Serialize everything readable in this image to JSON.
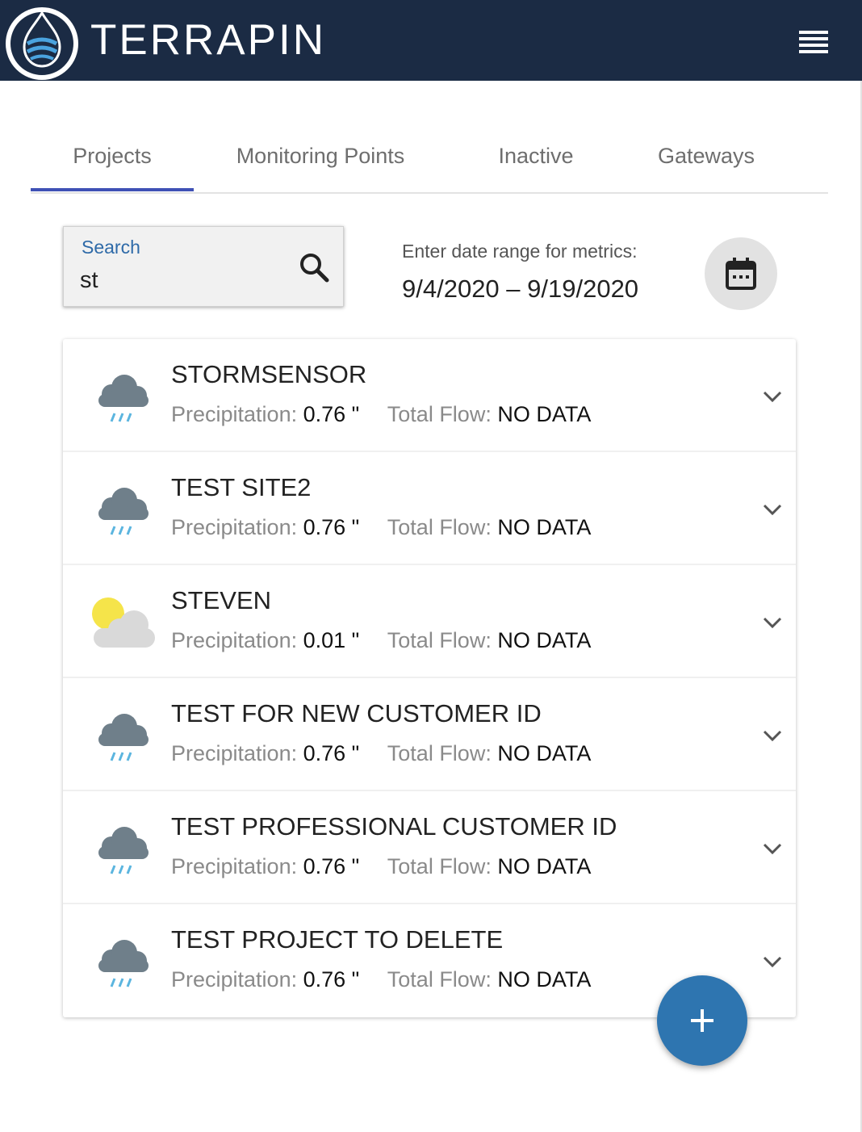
{
  "header": {
    "brand": "TERRAPIN",
    "logo_icon": "water-drop-logo-icon",
    "menu_icon": "hamburger-menu-icon",
    "background_color": "#1b2b44"
  },
  "tabs": [
    {
      "label": "Projects",
      "active": true
    },
    {
      "label": "Monitoring Points",
      "active": false
    },
    {
      "label": "Inactive",
      "active": false
    },
    {
      "label": "Gateways",
      "active": false
    }
  ],
  "search": {
    "label": "Search",
    "value": "st",
    "icon": "search-icon"
  },
  "date_filter": {
    "label": "Enter date range for metrics:",
    "range": "9/4/2020 – 9/19/2020",
    "icon": "calendar-icon"
  },
  "projects": [
    {
      "name": "STORMSENSOR",
      "weather_icon": "rain-cloud-icon",
      "precip_label": "Precipitation:",
      "precip_value": "0.76 \"",
      "flow_label": "Total Flow:",
      "flow_value": "NO DATA"
    },
    {
      "name": "TEST SITE2",
      "weather_icon": "rain-cloud-icon",
      "precip_label": "Precipitation:",
      "precip_value": "0.76 \"",
      "flow_label": "Total Flow:",
      "flow_value": "NO DATA"
    },
    {
      "name": "STEVEN",
      "weather_icon": "partly-cloudy-icon",
      "precip_label": "Precipitation:",
      "precip_value": "0.01 \"",
      "flow_label": "Total Flow:",
      "flow_value": "NO DATA"
    },
    {
      "name": "TEST FOR NEW CUSTOMER ID",
      "weather_icon": "rain-cloud-icon",
      "precip_label": "Precipitation:",
      "precip_value": "0.76 \"",
      "flow_label": "Total Flow:",
      "flow_value": "NO DATA"
    },
    {
      "name": "TEST PROFESSIONAL CUSTOMER ID",
      "weather_icon": "rain-cloud-icon",
      "precip_label": "Precipitation:",
      "precip_value": "0.76 \"",
      "flow_label": "Total Flow:",
      "flow_value": "NO DATA"
    },
    {
      "name": "TEST PROJECT TO DELETE",
      "weather_icon": "rain-cloud-icon",
      "precip_label": "Precipitation:",
      "precip_value": "0.76 \"",
      "flow_label": "Total Flow:",
      "flow_value": "NO DATA"
    }
  ],
  "fab": {
    "icon": "plus-icon",
    "color": "#2e75b0"
  },
  "colors": {
    "tab_indicator": "#3f51b5",
    "search_label": "#2e6aa8"
  }
}
